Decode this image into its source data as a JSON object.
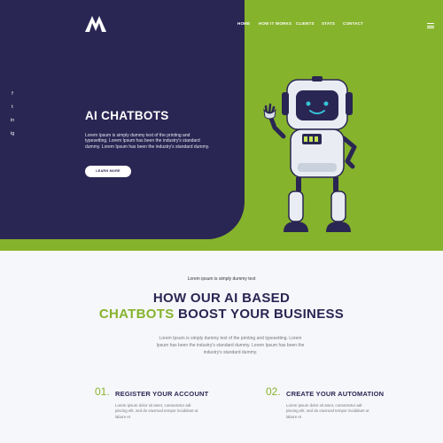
{
  "brand": {
    "logo_name": "M logo"
  },
  "nav": {
    "items": [
      "HOME",
      "HOW IT WORKS",
      "CLIENTS",
      "STATS",
      "CONTACT"
    ]
  },
  "social": [
    "f",
    "t",
    "in",
    "ig"
  ],
  "hero": {
    "title": "AI CHATBOTS",
    "description": "Lorem Ipsum is simply dummy text of the printing and typesetting. Lorem Ipsum has been the industry's standard dummy.  Lorem Ipsum has been the industry's standard dummy.",
    "button": "LEARN MORE"
  },
  "section": {
    "kicker": "Lorem ipsum is simply dummy text",
    "headline_line1": "HOW OUR AI BASED",
    "headline_highlight": "CHATBOTS",
    "headline_rest": " BOOST YOUR BUSINESS",
    "description": "Lorem Ipsum is simply dummy text of the printing and typesetting. Lorem Ipsum has been the industry's standard dummy.  Lorem Ipsum has been the industry's standard dummy."
  },
  "features": [
    {
      "number": "01.",
      "title": "REGISTER YOUR ACCOUNT",
      "description": "Lorem ipsum dolor sit amet, consectetur adi-piscing elit, sed do eiusmod tempor incididunt ut labore et"
    },
    {
      "number": "02.",
      "title": "CREATE YOUR AUTOMATION",
      "description": "Lorem ipsum dolor sit amet, consectetur adi-piscing elit, sed do eiusmod tempor incididunt ut labore et"
    }
  ],
  "colors": {
    "navy": "#2a2653",
    "green": "#86b32c",
    "light": "#f6f7fb"
  }
}
